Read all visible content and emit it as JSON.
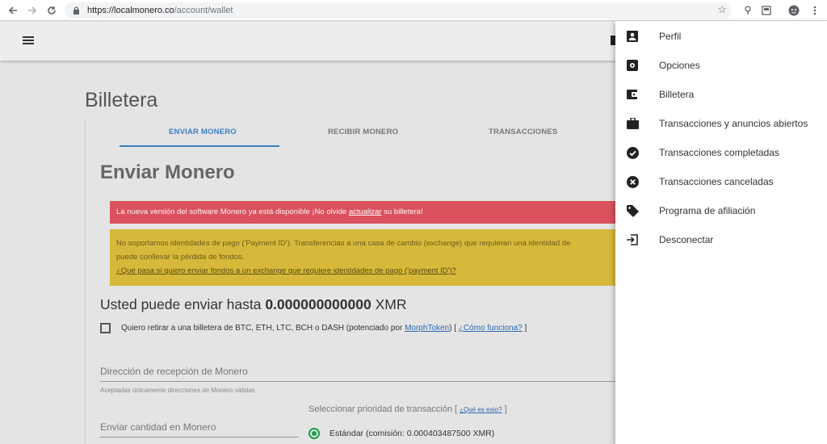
{
  "browser": {
    "url_host": "https://localmonero.co",
    "url_path": "/account/wallet"
  },
  "page": {
    "title": "Billetera",
    "tabs": [
      {
        "label": "ENVIAR MONERO",
        "active": true
      },
      {
        "label": "RECIBIR MONERO",
        "active": false
      },
      {
        "label": "TRANSACCIONES",
        "active": false
      }
    ],
    "section_title": "Enviar Monero",
    "alert_red": {
      "prefix": "La nueva versión del software Monero ya está disponible ¡No olvide ",
      "link": "actualizar",
      "suffix": " su billetera!"
    },
    "alert_yellow": {
      "line1": "No soportamos identidades de pago ('Payment ID'). Transferencias a una casa de cambio (exchange) que requieran una identidad de",
      "line2": "puede conllevar la pérdida de fondos.",
      "faq_link": "¿Qué pasa si quiero enviar fondos a un exchange que requiere identidades de pago ('payment ID')?"
    },
    "balance": {
      "prefix": "Usted puede enviar hasta ",
      "amount": "0.000000000000",
      "currency": " XMR"
    },
    "checkbox": {
      "label_prefix": "Quiero retirar a una billetera de BTC, ETH, LTC, BCH o DASH (potenciado por ",
      "link1": "MorphToken",
      "middle": ") [ ",
      "link2": "¿Cómo funciona?",
      "suffix": " ]",
      "checked": false
    },
    "address_field": {
      "label": "Dirección de recepción de Monero",
      "helper": "Aceptadas únicamente direcciones de Monero válidas"
    },
    "amount_field": {
      "label": "Enviar cantidad en Monero"
    },
    "priority": {
      "label": "Seleccionar prioridad de transacción",
      "open_bracket": " [ ",
      "link": "¿Qué es esto?",
      "close_bracket": " ]",
      "selected_option": "Estándar (comisión: 0.000403487500 XMR)"
    }
  },
  "menu": {
    "items": [
      {
        "label": "Perfil",
        "icon": "profile-icon"
      },
      {
        "label": "Opciones",
        "icon": "settings-icon"
      },
      {
        "label": "Billetera",
        "icon": "wallet-icon"
      },
      {
        "label": "Transacciones y anuncios abiertos",
        "icon": "briefcase-icon"
      },
      {
        "label": "Transacciones completadas",
        "icon": "check-circle-icon"
      },
      {
        "label": "Transacciones canceladas",
        "icon": "cancel-circle-icon"
      },
      {
        "label": "Programa de afiliación",
        "icon": "tag-icon"
      },
      {
        "label": "Desconectar",
        "icon": "logout-icon"
      }
    ]
  },
  "colors": {
    "accent": "#3c7fc4",
    "alert_red": "#d9525e",
    "alert_yellow": "#d6b93a",
    "radio_green": "#1e9e4a"
  }
}
